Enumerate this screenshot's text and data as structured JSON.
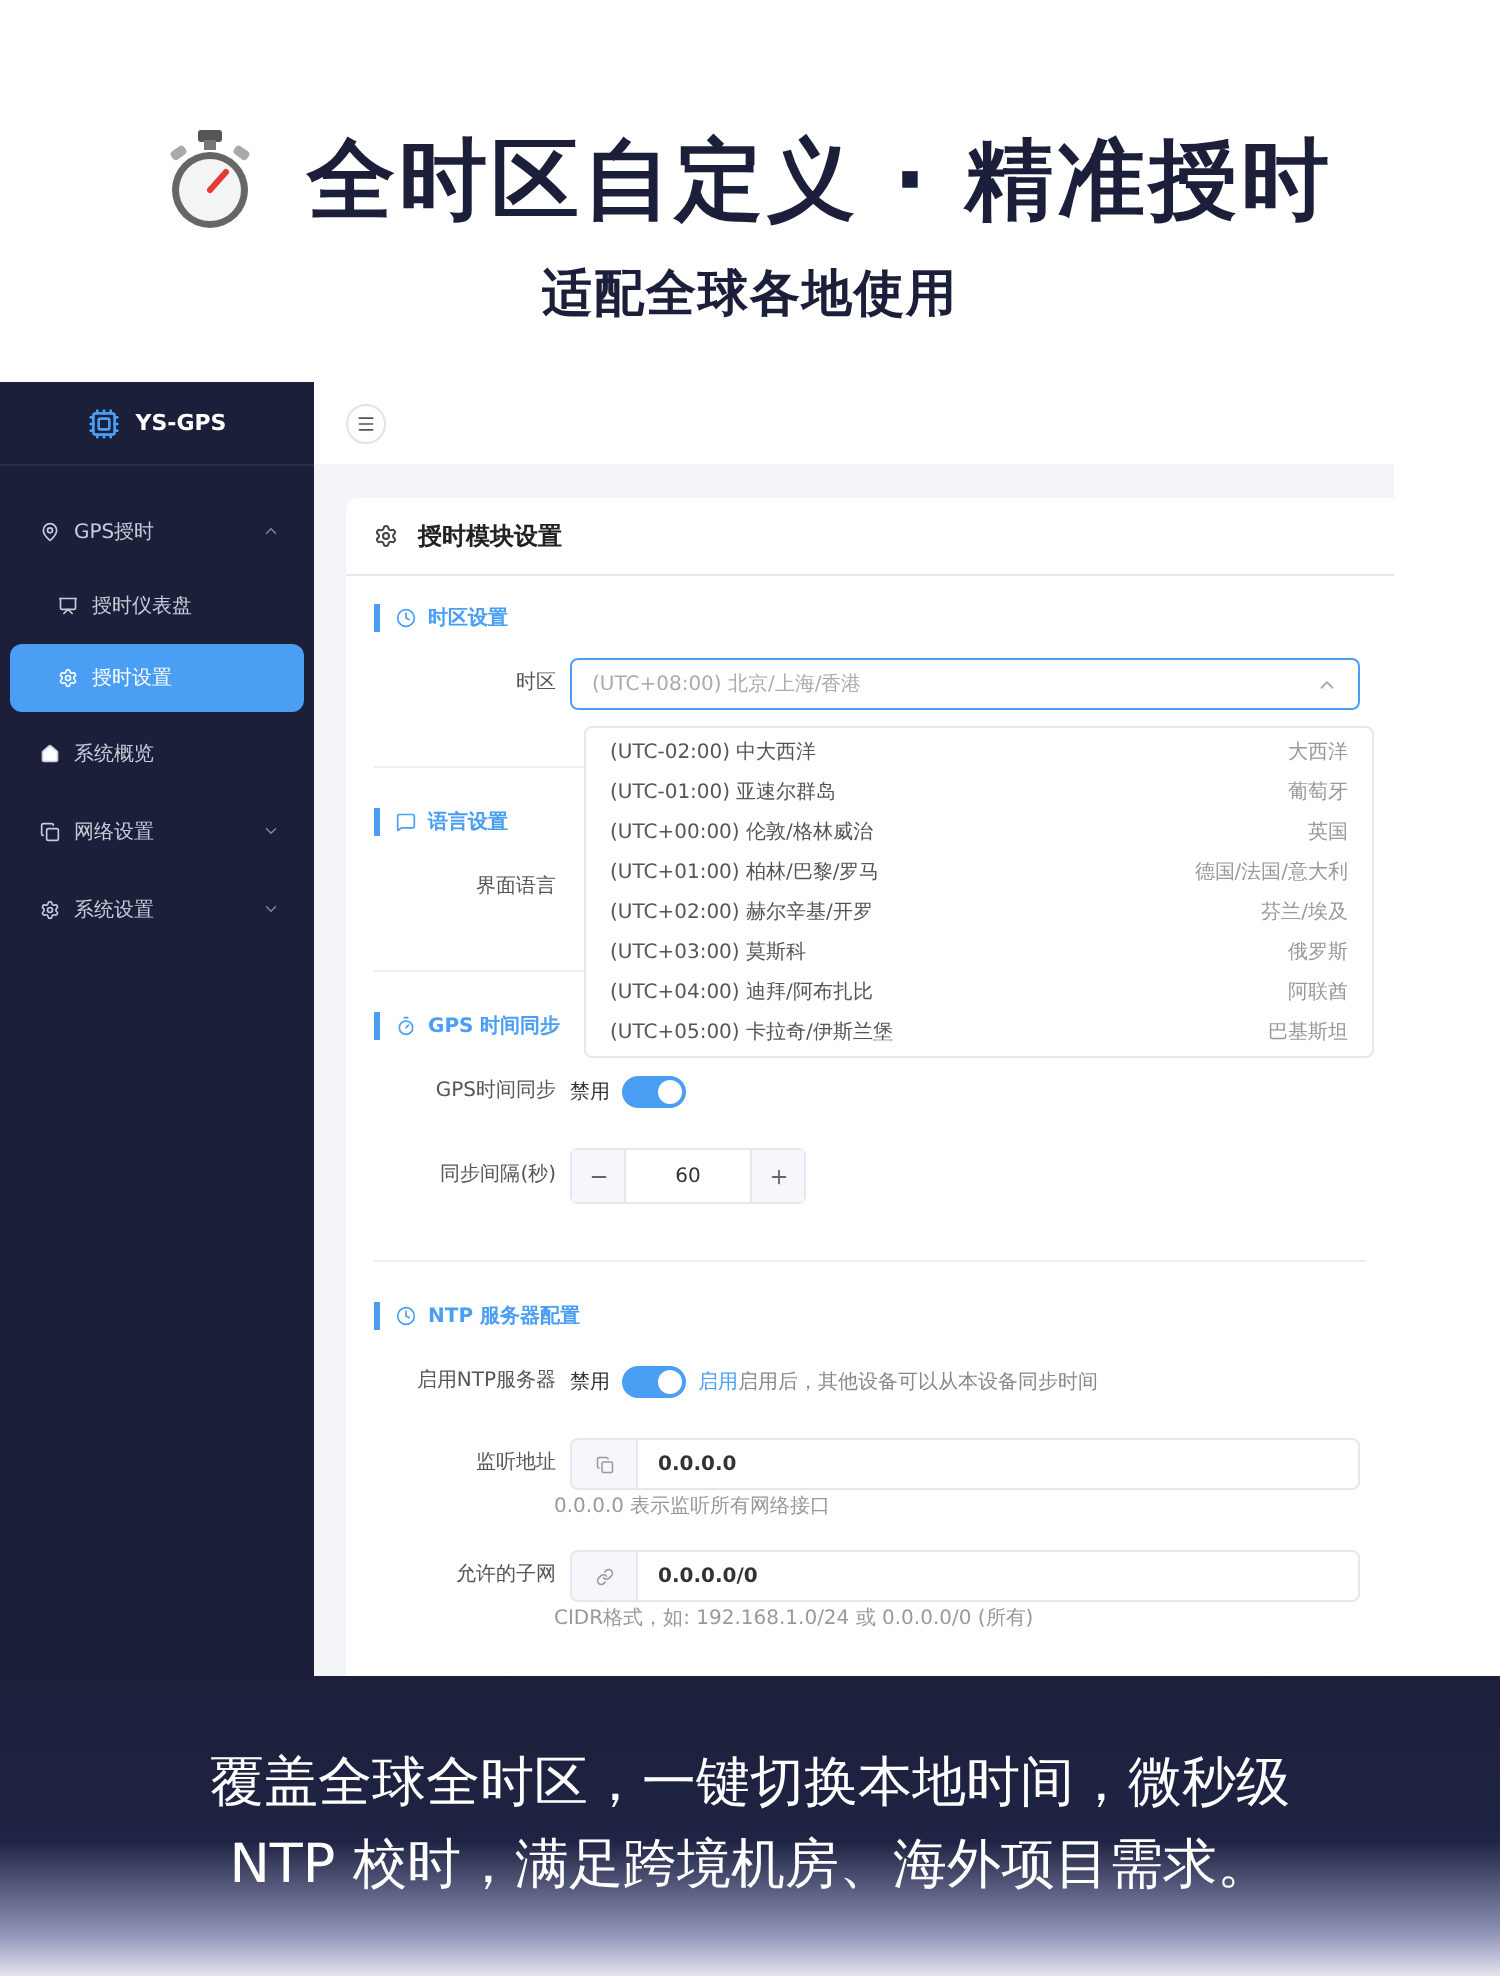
{
  "headline": {
    "title": "全时区自定义 · 精准授时",
    "subtitle": "适配全球各地使用"
  },
  "sidebar": {
    "brand": "YS-GPS",
    "items": [
      {
        "kind": "group",
        "label": "GPS授时",
        "selected": false,
        "expanded": true,
        "children": [
          {
            "label": "授时仪表盘",
            "selected": false
          },
          {
            "label": "授时设置",
            "selected": true
          }
        ]
      },
      {
        "kind": "link",
        "label": "系统概览",
        "selected": false
      },
      {
        "kind": "group",
        "label": "网络设置",
        "selected": false,
        "expanded": false
      },
      {
        "kind": "group",
        "label": "系统设置",
        "selected": false,
        "expanded": false
      }
    ]
  },
  "panel": {
    "title": "授时模块设置",
    "sections": [
      {
        "title": "时区设置",
        "rows": [
          {
            "kind": "select",
            "label": "时区",
            "placeholder": "(UTC+08:00) 北京/上海/香港",
            "expanded": true,
            "options": [
              {
                "label": "(UTC-02:00) 中大西洋",
                "region": "大西洋"
              },
              {
                "label": "(UTC-01:00) 亚速尔群岛",
                "region": "葡萄牙"
              },
              {
                "label": "(UTC+00:00) 伦敦/格林威治",
                "region": "英国"
              },
              {
                "label": "(UTC+01:00) 柏林/巴黎/罗马",
                "region": "德国/法国/意大利"
              },
              {
                "label": "(UTC+02:00) 赫尔辛基/开罗",
                "region": "芬兰/埃及"
              },
              {
                "label": "(UTC+03:00) 莫斯科",
                "region": "俄罗斯"
              },
              {
                "label": "(UTC+04:00) 迪拜/阿布扎比",
                "region": "阿联酋"
              },
              {
                "label": "(UTC+05:00) 卡拉奇/伊斯兰堡",
                "region": "巴基斯坦"
              }
            ]
          }
        ]
      },
      {
        "title": "语言设置",
        "rows": [
          {
            "kind": "label_only",
            "label": "界面语言"
          }
        ]
      },
      {
        "title": "GPS 时间同步",
        "rows": [
          {
            "kind": "switch",
            "label": "GPS时间同步",
            "off_text": "禁用",
            "on": true
          },
          {
            "kind": "stepper",
            "label": "同步间隔(秒)",
            "value": "60"
          }
        ]
      },
      {
        "title": "NTP 服务器配置",
        "rows": [
          {
            "kind": "switch",
            "label": "启用NTP服务器",
            "off_text": "禁用",
            "on": true,
            "on_text": "启用",
            "hint": "启用后，其他设备可以从本设备同步时间"
          },
          {
            "kind": "input",
            "label": "监听地址",
            "value": "0.0.0.0",
            "help": "0.0.0.0 表示监听所有网络接口"
          },
          {
            "kind": "input",
            "label": "允许的子网",
            "value": "0.0.0.0/0",
            "help": "CIDR格式，如: 192.168.1.0/24 或 0.0.0.0/0 (所有)"
          }
        ]
      }
    ]
  },
  "banner": {
    "lines": [
      "覆盖全球全时区，一键切换本地时间，微秒级",
      "NTP 校时，满足跨境机房、海外项目需求。"
    ]
  }
}
